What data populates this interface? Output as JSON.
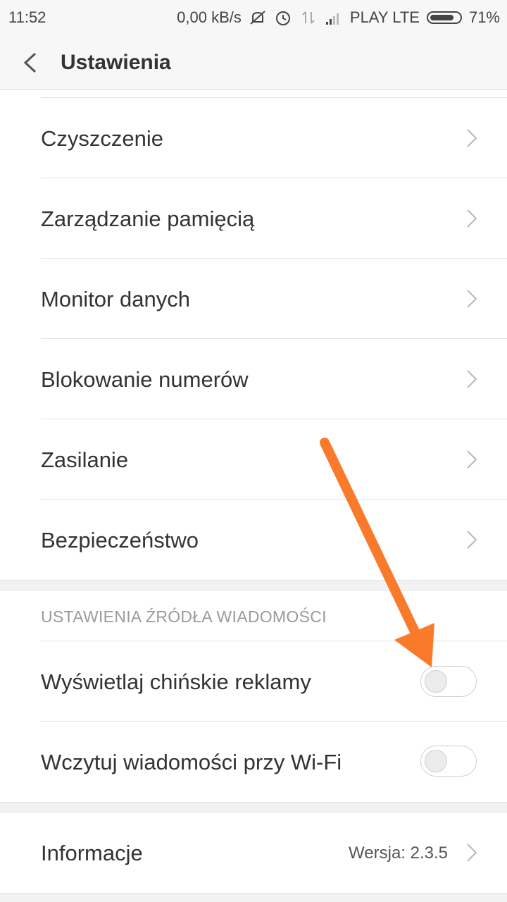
{
  "status_bar": {
    "time": "11:52",
    "net_speed": "0,00 kB/s",
    "carrier": "PLAY LTE",
    "battery": "71%",
    "icons": [
      "silent-icon",
      "alarm-icon",
      "data-arrows-icon",
      "signal-icon",
      "battery-icon"
    ]
  },
  "header": {
    "title": "Ustawienia"
  },
  "menu": {
    "items": [
      {
        "label": "Czyszczenie"
      },
      {
        "label": "Zarządzanie pamięcią"
      },
      {
        "label": "Monitor danych"
      },
      {
        "label": "Blokowanie numerów"
      },
      {
        "label": "Zasilanie"
      },
      {
        "label": "Bezpieczeństwo"
      }
    ]
  },
  "news_section": {
    "header": "USTAWIENIA ŹRÓDŁA WIADOMOŚCI",
    "items": [
      {
        "label": "Wyświetlaj chińskie reklamy",
        "enabled": false
      },
      {
        "label": "Wczytuj wiadomości przy Wi-Fi",
        "enabled": false
      }
    ]
  },
  "info": {
    "label": "Informacje",
    "version": "Wersja: 2.3.5"
  },
  "colors": {
    "annotation_arrow": "#f97a2b",
    "background": "#f2f2f2"
  }
}
